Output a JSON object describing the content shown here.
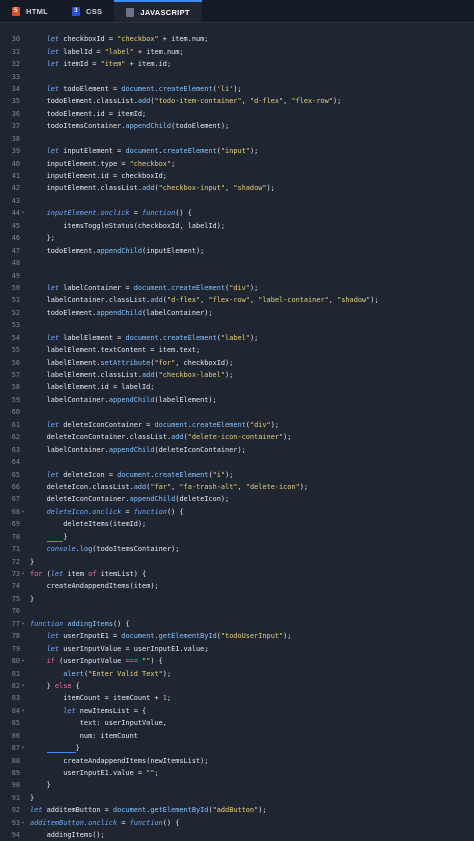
{
  "tabs": [
    {
      "label": "HTML",
      "icon": "html5-icon",
      "color": "#e44d26"
    },
    {
      "label": "CSS",
      "icon": "css3-icon",
      "color": "#264de4"
    },
    {
      "label": "JAVASCRIPT",
      "icon": "js-file-icon",
      "color": "#6c7687"
    }
  ],
  "active_tab": "JAVASCRIPT",
  "lines": [
    {
      "n": "30",
      "fold": "",
      "html": "    <span class=\"k\">let</span> checkboxId = <span class=\"s\">\"checkbox\"</span> + item.num;"
    },
    {
      "n": "31",
      "fold": "",
      "html": "    <span class=\"k\">let</span> labelId = <span class=\"s\">\"label\"</span> + item.num;"
    },
    {
      "n": "32",
      "fold": "",
      "html": "    <span class=\"k\">let</span> itemId = <span class=\"s\">\"item\"</span> + item.id;"
    },
    {
      "n": "33",
      "fold": "",
      "html": ""
    },
    {
      "n": "34",
      "fold": "",
      "html": "    <span class=\"k\">let</span> todoElement = <span class=\"f\">document</span>.<span class=\"f\">createElement</span>(<span class=\"s\">'li'</span>);"
    },
    {
      "n": "35",
      "fold": "",
      "html": "    todoElement.classList.<span class=\"f\">add</span>(<span class=\"s\">\"todo-item-container\"</span>, <span class=\"s\">\"d-flex\"</span>, <span class=\"s\">\"flex-row\"</span>);"
    },
    {
      "n": "36",
      "fold": "",
      "html": "    todoElement.id = itemId;"
    },
    {
      "n": "37",
      "fold": "",
      "html": "    todoItemsContainer.<span class=\"f\">appendChild</span>(todoElement);"
    },
    {
      "n": "38",
      "fold": "",
      "html": ""
    },
    {
      "n": "39",
      "fold": "",
      "html": "    <span class=\"k\">let</span> inputElement = <span class=\"f\">document</span>.<span class=\"f\">createElement</span>(<span class=\"s\">\"input\"</span>);"
    },
    {
      "n": "40",
      "fold": "",
      "html": "    inputElement.type = <span class=\"s\">\"checkbox\"</span>;"
    },
    {
      "n": "41",
      "fold": "",
      "html": "    inputElement.id = checkboxId;"
    },
    {
      "n": "42",
      "fold": "",
      "html": "    inputElement.classList.<span class=\"f\">add</span>(<span class=\"s\">\"checkbox-input\"</span>, <span class=\"s\">\"shadow\"</span>);"
    },
    {
      "n": "43",
      "fold": "",
      "html": ""
    },
    {
      "n": "44",
      "fold": "▾",
      "html": "    <span class=\"ifn\">inputElement.onclick</span> = <span class=\"k\">function</span>() {"
    },
    {
      "n": "45",
      "fold": "",
      "html": "        <span class=\"p\">itemsToggleStatus</span>(checkboxId, labelId);"
    },
    {
      "n": "46",
      "fold": "",
      "html": "    };"
    },
    {
      "n": "47",
      "fold": "",
      "html": "    todoElement.<span class=\"f\">appendChild</span>(inputElement);"
    },
    {
      "n": "48",
      "fold": "",
      "html": ""
    },
    {
      "n": "49",
      "fold": "",
      "html": ""
    },
    {
      "n": "50",
      "fold": "",
      "html": "    <span class=\"k\">let</span> labelContainer = <span class=\"f\">document</span>.<span class=\"f\">createElement</span>(<span class=\"s\">\"div\"</span>);"
    },
    {
      "n": "51",
      "fold": "",
      "html": "    labelContainer.classList.<span class=\"f\">add</span>(<span class=\"s\">\"d-flex\"</span>, <span class=\"s\">\"flex-row\"</span>, <span class=\"s\">\"label-container\"</span>, <span class=\"s\">\"shadow\"</span>);"
    },
    {
      "n": "52",
      "fold": "",
      "html": "    todoElement.<span class=\"f\">appendChild</span>(labelContainer);"
    },
    {
      "n": "53",
      "fold": "",
      "html": ""
    },
    {
      "n": "54",
      "fold": "",
      "html": "    <span class=\"k\">let</span> labelElement = <span class=\"f\">document</span>.<span class=\"f\">createElement</span>(<span class=\"s\">\"label\"</span>);"
    },
    {
      "n": "55",
      "fold": "",
      "html": "    labelElement.textContent = item.text;"
    },
    {
      "n": "56",
      "fold": "",
      "html": "    labelElement.<span class=\"f\">setAttribute</span>(<span class=\"s\">\"for\"</span>, checkboxId);"
    },
    {
      "n": "57",
      "fold": "",
      "html": "    labelElement.classList.<span class=\"f\">add</span>(<span class=\"s\">\"checkbox-label\"</span>);"
    },
    {
      "n": "58",
      "fold": "",
      "html": "    labelElement.id = labelId;"
    },
    {
      "n": "59",
      "fold": "",
      "html": "    labelContainer.<span class=\"f\">appendChild</span>(labelElement);"
    },
    {
      "n": "60",
      "fold": "",
      "html": ""
    },
    {
      "n": "61",
      "fold": "",
      "html": "    <span class=\"k\">let</span> deleteIconContainer = <span class=\"f\">document</span>.<span class=\"f\">createElement</span>(<span class=\"s\">\"div\"</span>);"
    },
    {
      "n": "62",
      "fold": "",
      "html": "    deleteIconContainer.classList.<span class=\"f\">add</span>(<span class=\"s\">\"delete-icon-container\"</span>);"
    },
    {
      "n": "63",
      "fold": "",
      "html": "    labelContainer.<span class=\"f\">appendChild</span>(deleteIconContainer);"
    },
    {
      "n": "64",
      "fold": "",
      "html": ""
    },
    {
      "n": "65",
      "fold": "",
      "html": "    <span class=\"k\">let</span> deleteIcon = <span class=\"f\">document</span>.<span class=\"f\">createElement</span>(<span class=\"s\">\"i\"</span>);"
    },
    {
      "n": "66",
      "fold": "",
      "html": "    deleteIcon.classList.<span class=\"f\">add</span>(<span class=\"s\">\"far\"</span>, <span class=\"s\">\"fa-trash-alt\"</span>, <span class=\"s\">\"delete-icon\"</span>);"
    },
    {
      "n": "67",
      "fold": "",
      "html": "    deleteIconContainer.<span class=\"f\">appendChild</span>(deleteIcon);"
    },
    {
      "n": "68",
      "fold": "▾",
      "html": "    <span class=\"ifn\">deleteIcon.onclick</span> = <span class=\"k\">function</span>() {"
    },
    {
      "n": "69",
      "fold": "",
      "html": "        <span class=\"p\">deleteItems</span>(itemId);"
    },
    {
      "n": "70",
      "fold": "",
      "html": "    <span class=\"underline-hl\">&nbsp;&nbsp;&nbsp;&nbsp;</span>}"
    },
    {
      "n": "71",
      "fold": "",
      "html": "    <span class=\"ifn\">console</span>.<span class=\"f\">log</span>(todoItemsContainer);"
    },
    {
      "n": "72",
      "fold": "",
      "html": "}"
    },
    {
      "n": "73",
      "fold": "▾",
      "html": "<span class=\"o\">for</span> (<span class=\"k\">let</span> item <span class=\"o\">of</span> itemList) {"
    },
    {
      "n": "74",
      "fold": "",
      "html": "    <span class=\"p\">createAndappendItems</span>(item);"
    },
    {
      "n": "75",
      "fold": "",
      "html": "}"
    },
    {
      "n": "76",
      "fold": "",
      "html": ""
    },
    {
      "n": "77",
      "fold": "▾",
      "html": "<span class=\"k\">function</span> <span class=\"f\">addingItems</span>() {"
    },
    {
      "n": "78",
      "fold": "",
      "html": "    <span class=\"k\">let</span> userInputE1 = <span class=\"f\">document</span>.<span class=\"f\">getElementById</span>(<span class=\"s\">\"todoUserInput\"</span>);"
    },
    {
      "n": "79",
      "fold": "",
      "html": "    <span class=\"k\">let</span> userInputValue = userInputE1.value;"
    },
    {
      "n": "80",
      "fold": "▾",
      "html": "    <span class=\"o\">if</span> (userInputValue <span class=\"o\">===</span> <span class=\"s\">\"\"</span>) {"
    },
    {
      "n": "81",
      "fold": "",
      "html": "        <span class=\"f\">alert</span>(<span class=\"s\">\"Enter Valid Text\"</span>);"
    },
    {
      "n": "82",
      "fold": "▾",
      "html": "    } <span class=\"o\">else</span> {"
    },
    {
      "n": "83",
      "fold": "",
      "html": "        itemCount = itemCount + <span class=\"n\">1</span>;"
    },
    {
      "n": "84",
      "fold": "▾",
      "html": "        <span class=\"k\">let</span> newItemsList = {"
    },
    {
      "n": "85",
      "fold": "",
      "html": "            text: userInputValue,"
    },
    {
      "n": "86",
      "fold": "",
      "html": "            num: itemCount"
    },
    {
      "n": "87",
      "fold": "▾",
      "html": "    <span class=\"underline-hl\">&nbsp;&nbsp;&nbsp;&nbsp;&nbsp;&nbsp;&nbsp;</span>}"
    },
    {
      "n": "88",
      "fold": "",
      "html": "        <span class=\"p\">createAndappendItems</span>(newItemsList);"
    },
    {
      "n": "89",
      "fold": "",
      "html": "        userInputE1.value = <span class=\"s\">\"\"</span>;"
    },
    {
      "n": "90",
      "fold": "",
      "html": "    }"
    },
    {
      "n": "91",
      "fold": "",
      "html": "}"
    },
    {
      "n": "92",
      "fold": "",
      "html": "<span class=\"k\">let</span> additemButton = <span class=\"f\">document</span>.<span class=\"f\">getElementById</span>(<span class=\"s\">\"addButton\"</span>);"
    },
    {
      "n": "93",
      "fold": "▾",
      "html": "<span class=\"ifn\">additemButton.onclick</span> = <span class=\"k\">function</span>() {"
    },
    {
      "n": "94",
      "fold": "",
      "html": "    <span class=\"p\">addingItems</span>();"
    }
  ]
}
